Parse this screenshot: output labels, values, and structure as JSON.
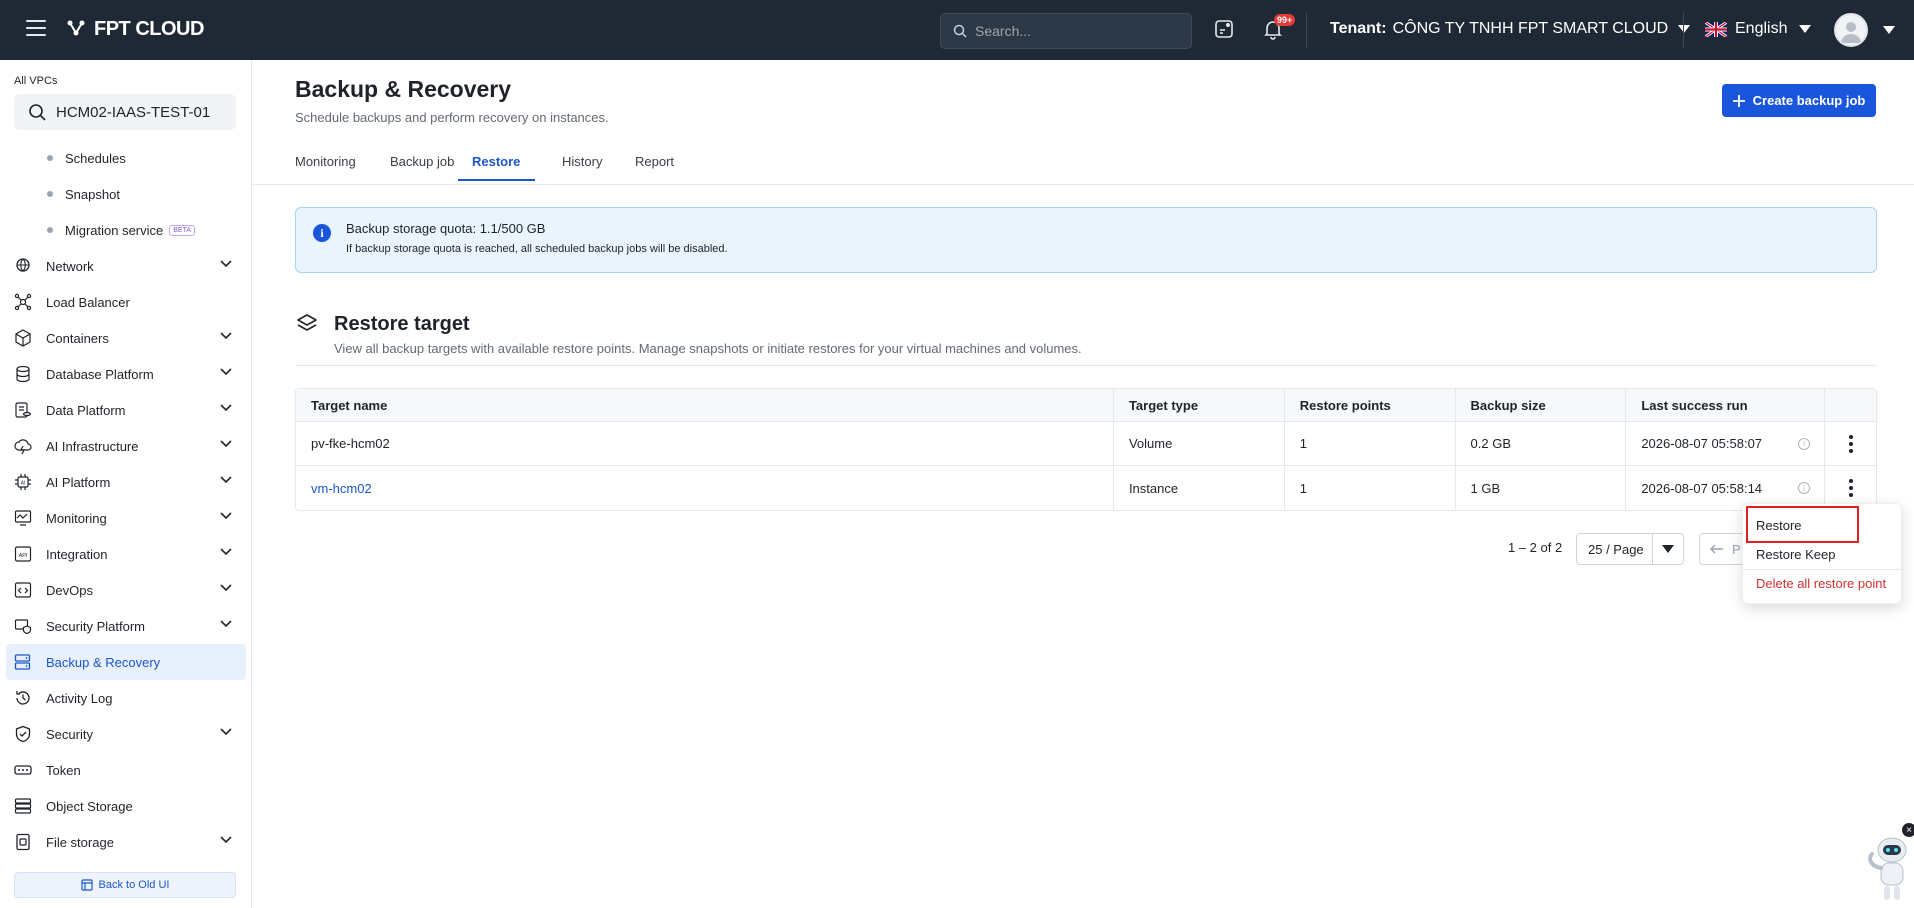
{
  "header": {
    "brand": "FPT CLOUD",
    "search_placeholder": "Search...",
    "notif_badge": "99+",
    "tenant_label": "Tenant:",
    "tenant_name": "CÔNG TY TNHH FPT SMART CLOUD",
    "language": "English"
  },
  "sidebar": {
    "vpc_label": "All VPCs",
    "vpc_value": "HCM02-IAAS-TEST-01",
    "sub_items": [
      {
        "label": "Schedules"
      },
      {
        "label": "Snapshot"
      },
      {
        "label": "Migration service",
        "badge": "BETA"
      }
    ],
    "items": [
      {
        "label": "Network",
        "icon": "globe-icon",
        "expandable": true
      },
      {
        "label": "Load Balancer",
        "icon": "load-balancer-icon",
        "expandable": false
      },
      {
        "label": "Containers",
        "icon": "cube-icon",
        "expandable": true
      },
      {
        "label": "Database Platform",
        "icon": "database-icon",
        "expandable": true
      },
      {
        "label": "Data Platform",
        "icon": "data-platform-icon",
        "expandable": true
      },
      {
        "label": "AI Infrastructure",
        "icon": "ai-infra-icon",
        "expandable": true
      },
      {
        "label": "AI Platform",
        "icon": "ai-chip-icon",
        "expandable": true
      },
      {
        "label": "Monitoring",
        "icon": "monitor-icon",
        "expandable": true
      },
      {
        "label": "Integration",
        "icon": "api-icon",
        "expandable": true
      },
      {
        "label": "DevOps",
        "icon": "code-icon",
        "expandable": true
      },
      {
        "label": "Security Platform",
        "icon": "security-platform-icon",
        "expandable": true
      },
      {
        "label": "Backup & Recovery",
        "icon": "backup-icon",
        "expandable": false,
        "active": true
      },
      {
        "label": "Activity Log",
        "icon": "history-icon",
        "expandable": false
      },
      {
        "label": "Security",
        "icon": "shield-icon",
        "expandable": true
      },
      {
        "label": "Token",
        "icon": "token-icon",
        "expandable": false
      },
      {
        "label": "Object Storage",
        "icon": "storage-icon",
        "expandable": false
      },
      {
        "label": "File storage",
        "icon": "file-storage-icon",
        "expandable": true
      }
    ],
    "back_old_ui": "Back to Old UI"
  },
  "main": {
    "title": "Backup & Recovery",
    "subtitle": "Schedule backups and perform recovery on instances.",
    "create_button": "Create backup job",
    "tabs": [
      {
        "label": "Monitoring"
      },
      {
        "label": "Backup job"
      },
      {
        "label": "Restore",
        "active": true
      },
      {
        "label": "History"
      },
      {
        "label": "Report"
      }
    ],
    "alert": {
      "title": "Backup storage quota: 1.1/500 GB",
      "description": "If backup storage quota is reached, all scheduled backup jobs will be disabled."
    },
    "section": {
      "title": "Restore target",
      "description": "View all backup targets with available restore points. Manage snapshots or initiate restores for your virtual machines and volumes."
    },
    "table": {
      "columns": [
        "Target name",
        "Target type",
        "Restore points",
        "Backup size",
        "Last success run"
      ],
      "rows": [
        {
          "name": "pv-fke-hcm02",
          "type": "Volume",
          "restore_points": "1",
          "size": "0.2 GB",
          "last_run": "2026-08-07 05:58:07",
          "link": false
        },
        {
          "name": "vm-hcm02",
          "type": "Instance",
          "restore_points": "1",
          "size": "1 GB",
          "last_run": "2026-08-07 05:58:14",
          "link": true
        }
      ]
    },
    "pagination": {
      "range": "1 – 2 of 2",
      "page_size": "25 / Page",
      "prev_label": "P"
    },
    "row_menu": {
      "items": [
        "Restore",
        "Restore Keep",
        "Delete all restore point"
      ]
    }
  },
  "colors": {
    "topbar": "#1f2935",
    "accent": "#1a56db",
    "danger": "#d32f2f"
  }
}
